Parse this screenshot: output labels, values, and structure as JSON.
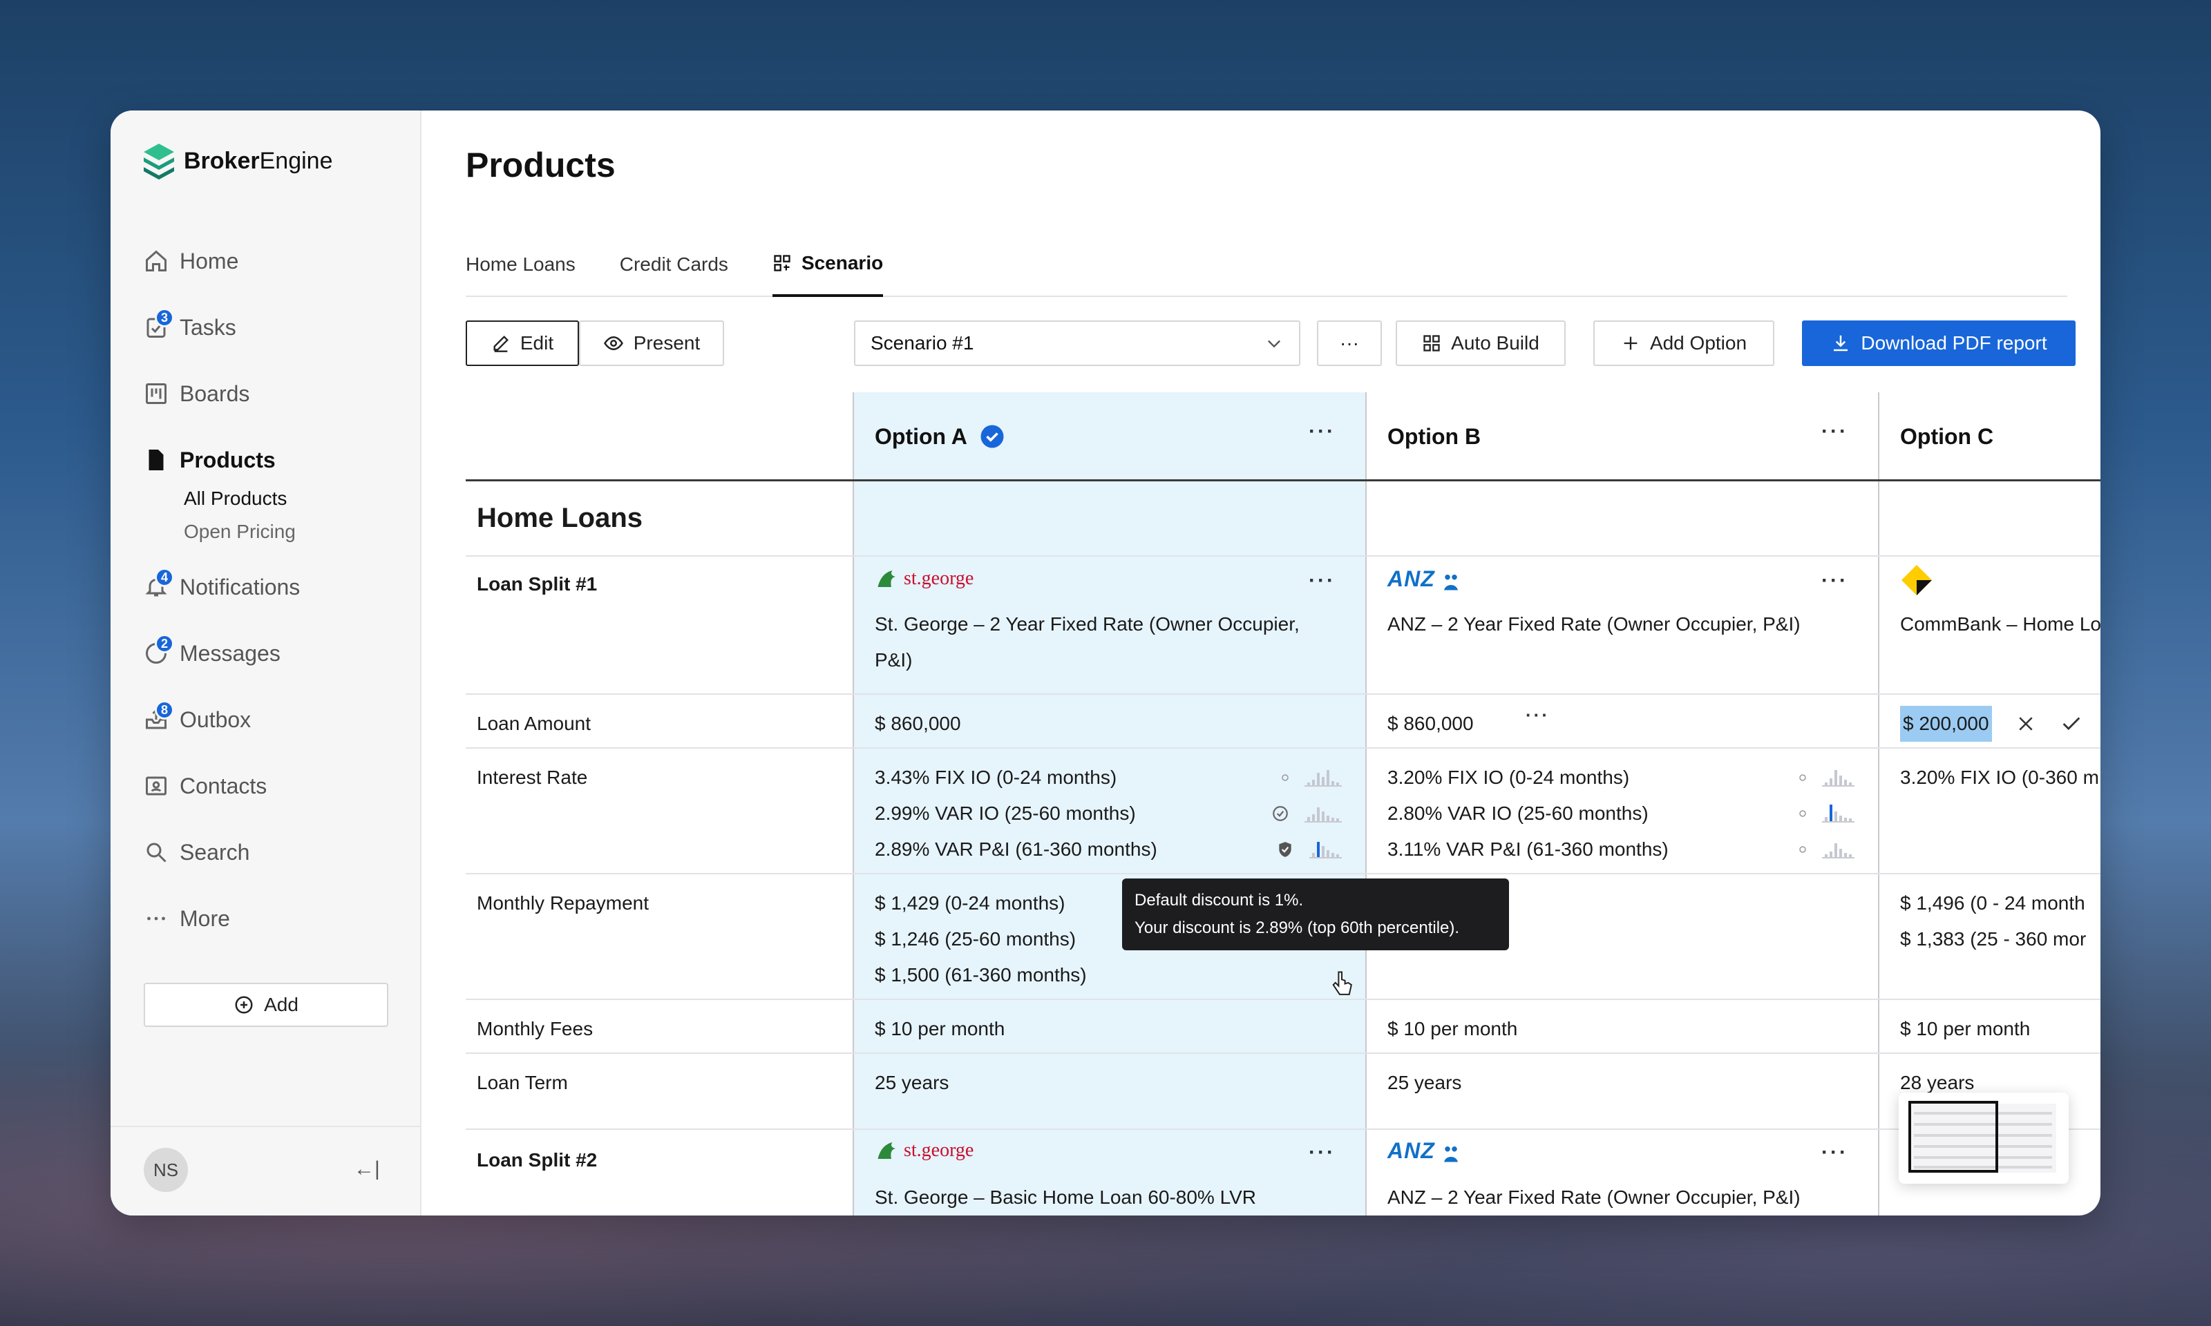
{
  "app": {
    "name_bold": "Broker",
    "name_light": "Engine"
  },
  "sidebar": {
    "items": [
      {
        "label": "Home",
        "icon": "home-icon",
        "badge": ""
      },
      {
        "label": "Tasks",
        "icon": "tasks-icon",
        "badge": "3"
      },
      {
        "label": "Boards",
        "icon": "boards-icon",
        "badge": ""
      },
      {
        "label": "Products",
        "icon": "document-icon",
        "badge": "",
        "active": true
      },
      {
        "label": "Notifications",
        "icon": "bell-icon",
        "badge": "4"
      },
      {
        "label": "Messages",
        "icon": "chat-icon",
        "badge": "2"
      },
      {
        "label": "Outbox",
        "icon": "outbox-icon",
        "badge": "8"
      },
      {
        "label": "Contacts",
        "icon": "contacts-icon",
        "badge": ""
      },
      {
        "label": "Search",
        "icon": "search-icon",
        "badge": ""
      },
      {
        "label": "More",
        "icon": "more-icon",
        "badge": ""
      }
    ],
    "subitems": [
      "All Products",
      "Open Pricing"
    ],
    "add_label": "Add",
    "avatar": "NS",
    "collapse_glyph": "←|"
  },
  "page": {
    "title": "Products"
  },
  "tabs": [
    "Home Loans",
    "Credit Cards",
    "Scenario"
  ],
  "toolbar": {
    "edit": "Edit",
    "present": "Present",
    "scenario": "Scenario #1",
    "auto_build": "Auto Build",
    "add_option": "Add Option",
    "download": "Download PDF report",
    "more": "···"
  },
  "options": {
    "a": "Option A",
    "b": "Option B",
    "c": "Option C"
  },
  "section": "Home Loans",
  "rows": {
    "split1": "Loan Split #1",
    "amount": "Loan Amount",
    "rate": "Interest Rate",
    "repay": "Monthly Repayment",
    "fees": "Monthly Fees",
    "term": "Loan Term",
    "split2": "Loan Split #2"
  },
  "lenders": {
    "stgeorge": "st.george",
    "anz": "ANZ"
  },
  "a": {
    "product": "St. George – 2 Year Fixed Rate (Owner Occupier, P&I)",
    "amount": "$ 860,000",
    "rates": [
      "3.43% FIX IO (0-24 months)",
      "2.99% VAR IO (25-60 months)",
      "2.89% VAR P&I (61-360 months)"
    ],
    "repay": [
      "$ 1,429 (0-24 months)",
      "$ 1,246 (25-60 months)",
      "$ 1,500 (61-360 months)"
    ],
    "fees": "$ 10 per month",
    "term": "25 years",
    "product2": "St. George – Basic Home Loan 60-80% LVR"
  },
  "b": {
    "product": "ANZ – 2 Year Fixed Rate (Owner Occupier, P&I)",
    "amount": "$ 860,000",
    "rates": [
      "3.20% FIX IO (0-24 months)",
      "2.80% VAR IO (25-60 months)",
      "3.11% VAR P&I (61-360 months)"
    ],
    "fees": "$ 10 per month",
    "term": "25 years",
    "product2": "ANZ – 2 Year Fixed Rate (Owner Occupier, P&I)"
  },
  "c": {
    "product": "CommBank – Home Lo",
    "amount": "$ 200,000",
    "rates": [
      "3.20% FIX IO (0-360 m"
    ],
    "repay": [
      "$ 1,496 (0 - 24 month",
      "$ 1,383 (25 - 360 mor"
    ],
    "fees": "$ 10 per month",
    "term": "28 years"
  },
  "tooltip": [
    "Default discount is 1%.",
    "Your discount is 2.89% (top 60th percentile)."
  ]
}
